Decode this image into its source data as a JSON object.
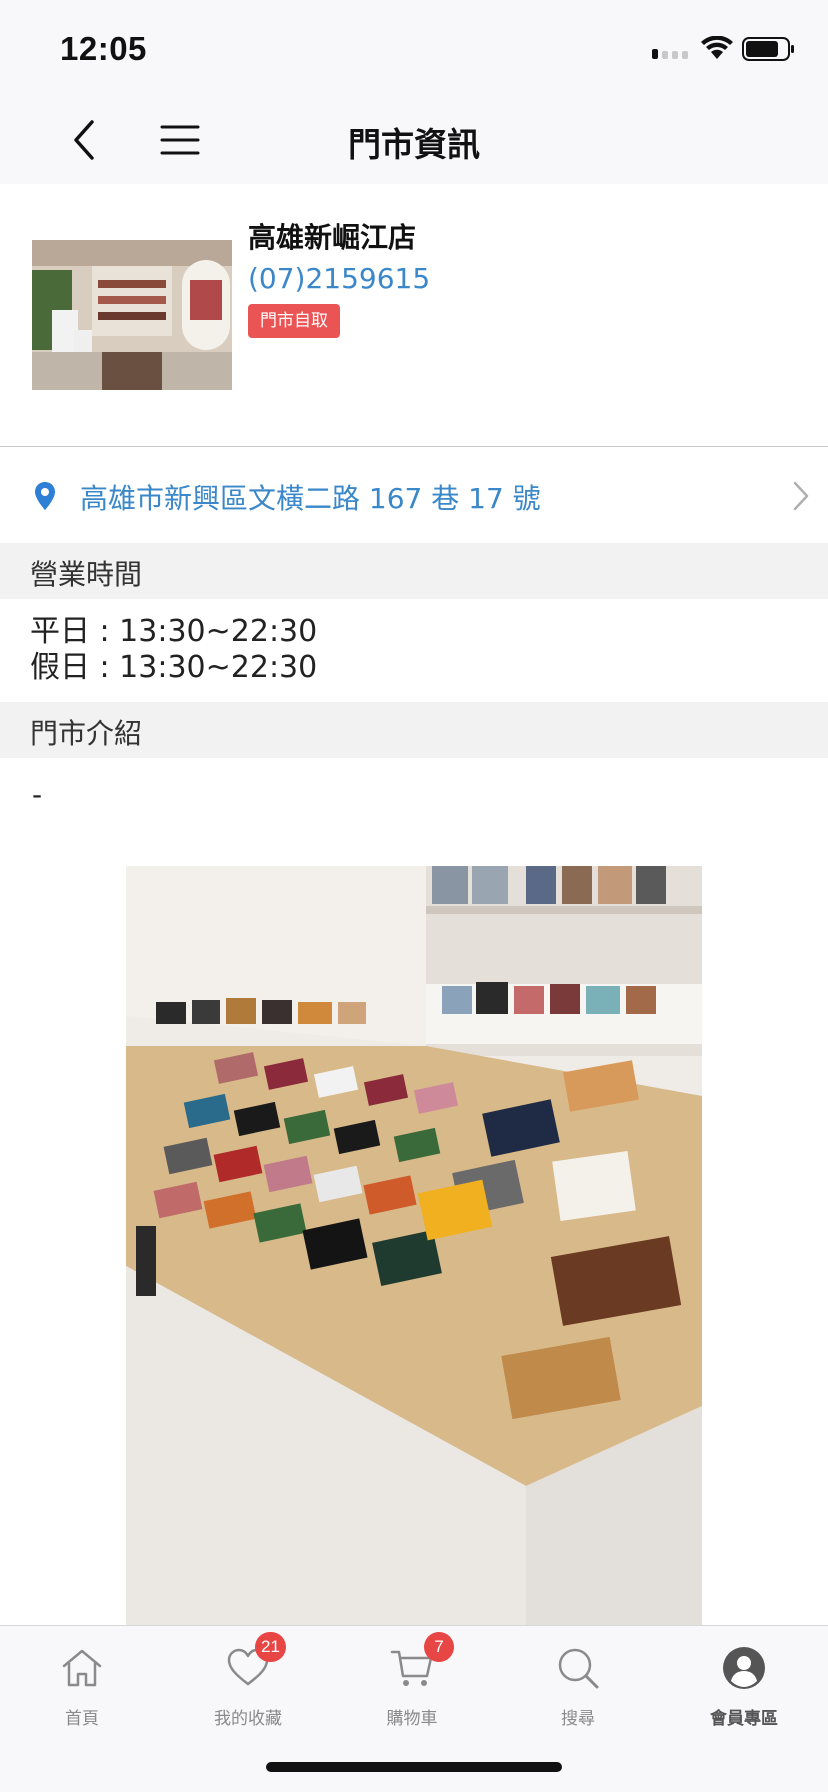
{
  "status_bar": {
    "time": "12:05"
  },
  "nav": {
    "title": "門市資訊"
  },
  "store": {
    "name": "高雄新崛江店",
    "phone": "(07)2159615",
    "badge": "門市自取",
    "address": "高雄市新興區文橫二路 167 巷 17 號"
  },
  "hours": {
    "header": "營業時間",
    "weekday": "平日 : 13:30~22:30",
    "holiday": "假日 : 13:30~22:30"
  },
  "intro": {
    "header": "門市介紹",
    "text": "-"
  },
  "tab_bar": {
    "items": [
      {
        "label": "首頁",
        "icon": "home-icon"
      },
      {
        "label": "我的收藏",
        "icon": "heart-icon",
        "badge": "21"
      },
      {
        "label": "購物車",
        "icon": "cart-icon",
        "badge": "7"
      },
      {
        "label": "搜尋",
        "icon": "search-icon"
      },
      {
        "label": "會員專區",
        "icon": "profile-icon"
      }
    ]
  },
  "colors": {
    "link": "#3a87c9",
    "badge": "#ea5454",
    "tab_badge": "#e84545"
  }
}
